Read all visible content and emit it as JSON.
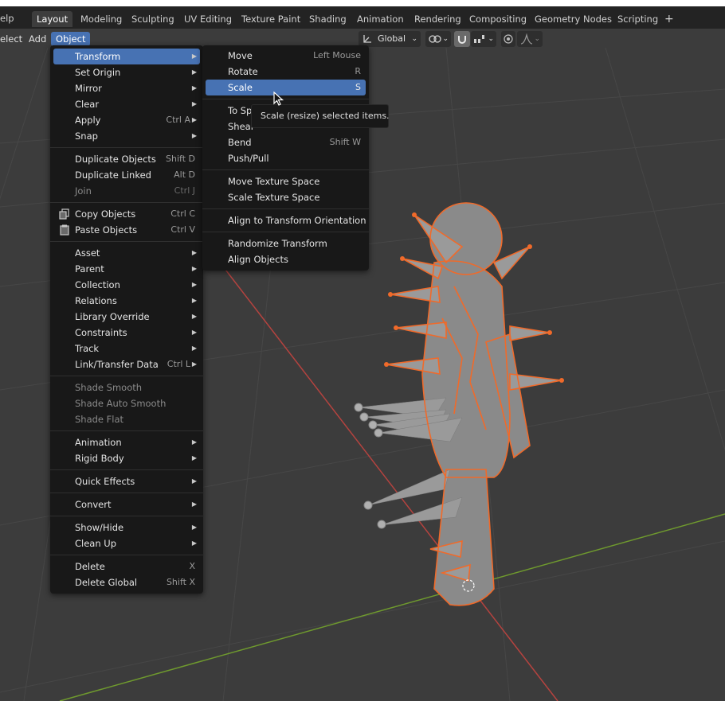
{
  "topbar": {
    "help_label": "elp",
    "tabs": [
      "Layout",
      "Modeling",
      "Sculpting",
      "UV Editing",
      "Texture Paint",
      "Shading",
      "Animation",
      "Rendering",
      "Compositing",
      "Geometry Nodes",
      "Scripting"
    ],
    "add_tab_label": "+"
  },
  "header": {
    "select_label": "elect",
    "add_label": "Add",
    "object_label": "Object",
    "orientation": "Global"
  },
  "object_menu": {
    "items": [
      {
        "label": "Transform",
        "shortcut": "",
        "submenu": true
      },
      {
        "label": "Set Origin",
        "shortcut": "",
        "submenu": true
      },
      {
        "label": "Mirror",
        "shortcut": "",
        "submenu": true
      },
      {
        "label": "Clear",
        "shortcut": "",
        "submenu": true
      },
      {
        "label": "Apply",
        "shortcut": "Ctrl A",
        "submenu": true
      },
      {
        "label": "Snap",
        "shortcut": "",
        "submenu": true
      },
      {
        "label": "Duplicate Objects",
        "shortcut": "Shift D"
      },
      {
        "label": "Duplicate Linked",
        "shortcut": "Alt D"
      },
      {
        "label": "Join",
        "shortcut": "Ctrl J"
      },
      {
        "label": "Copy Objects",
        "shortcut": "Ctrl C"
      },
      {
        "label": "Paste Objects",
        "shortcut": "Ctrl V"
      },
      {
        "label": "Asset",
        "submenu": true
      },
      {
        "label": "Parent",
        "submenu": true
      },
      {
        "label": "Collection",
        "submenu": true
      },
      {
        "label": "Relations",
        "submenu": true
      },
      {
        "label": "Library Override",
        "submenu": true
      },
      {
        "label": "Constraints",
        "submenu": true
      },
      {
        "label": "Track",
        "submenu": true
      },
      {
        "label": "Link/Transfer Data",
        "shortcut": "Ctrl L",
        "submenu": true
      },
      {
        "label": "Shade Smooth"
      },
      {
        "label": "Shade Auto Smooth"
      },
      {
        "label": "Shade Flat"
      },
      {
        "label": "Animation",
        "submenu": true
      },
      {
        "label": "Rigid Body",
        "submenu": true
      },
      {
        "label": "Quick Effects",
        "submenu": true
      },
      {
        "label": "Convert",
        "submenu": true
      },
      {
        "label": "Show/Hide",
        "submenu": true
      },
      {
        "label": "Clean Up",
        "submenu": true
      },
      {
        "label": "Delete",
        "shortcut": "X"
      },
      {
        "label": "Delete Global",
        "shortcut": "Shift X"
      }
    ]
  },
  "transform_menu": {
    "items": [
      {
        "label": "Move",
        "shortcut": "Left Mouse"
      },
      {
        "label": "Rotate",
        "shortcut": "R"
      },
      {
        "label": "Scale",
        "shortcut": "S"
      },
      {
        "label": "To Sp",
        "shortcut": ""
      },
      {
        "label": "Shear",
        "shortcut": ""
      },
      {
        "label": "Bend",
        "shortcut": "Shift W"
      },
      {
        "label": "Push/Pull",
        "shortcut": ""
      },
      {
        "label": "Move Texture Space",
        "shortcut": ""
      },
      {
        "label": "Scale Texture Space",
        "shortcut": ""
      },
      {
        "label": "Align to Transform Orientation",
        "shortcut": ""
      },
      {
        "label": "Randomize Transform",
        "shortcut": ""
      },
      {
        "label": "Align Objects",
        "shortcut": ""
      }
    ]
  },
  "tooltip": "Scale (resize) selected items.",
  "colors": {
    "highlight": "#4772b3",
    "selection_outline": "#f06a2a",
    "x_axis": "#b5433f",
    "y_axis": "#6f9a2e"
  }
}
